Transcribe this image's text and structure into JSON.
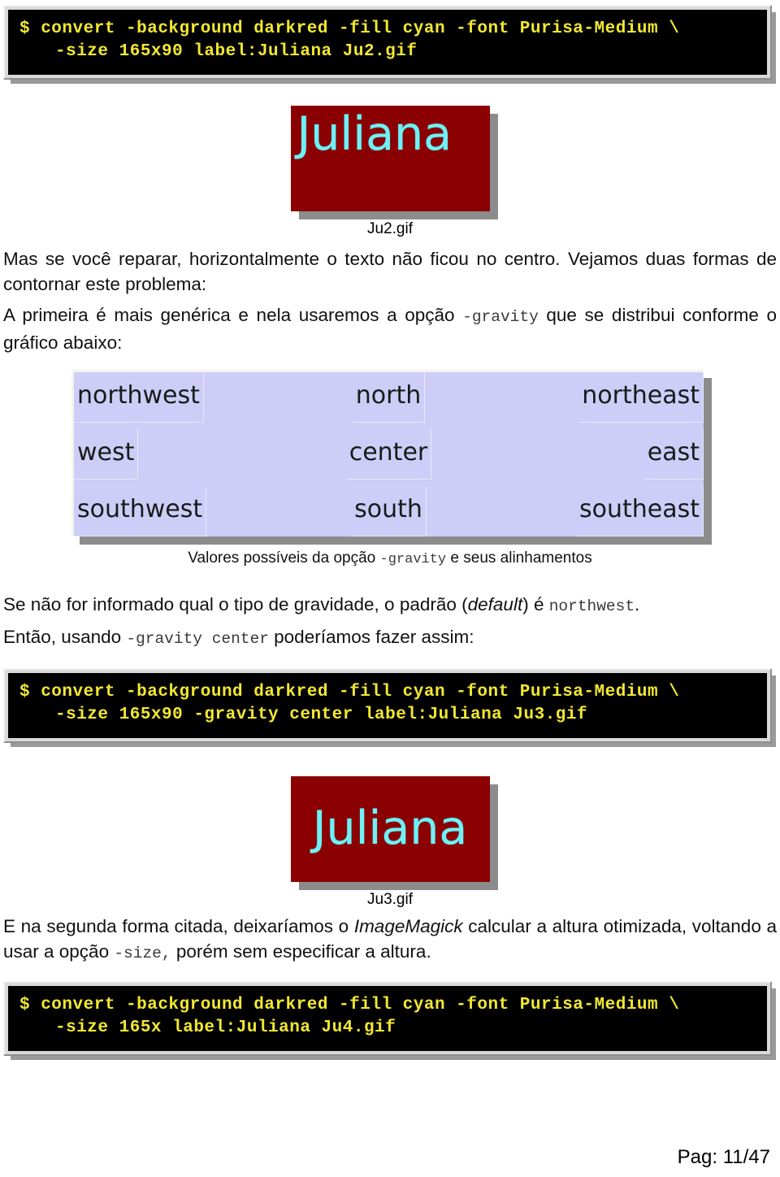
{
  "document": {
    "page_label": "Pag: 11/47"
  },
  "code_blocks": [
    {
      "id": "cmd-ju2",
      "line1": "$ convert -background darkred -fill cyan -font Purisa-Medium \\",
      "line2": "-size 165x90 label:Juliana Ju2.gif"
    },
    {
      "id": "cmd-ju3",
      "line1": "$ convert -background darkred -fill cyan -font Purisa-Medium \\",
      "line2": "-size 165x90 -gravity center label:Juliana Ju3.gif"
    },
    {
      "id": "cmd-ju4",
      "line1": "$ convert -background darkred -fill cyan -font Purisa-Medium \\",
      "line2": "-size 165x label:Juliana Ju4.gif"
    }
  ],
  "figures": [
    {
      "id": "ju2",
      "label": "Juliana",
      "caption": "Ju2.gif",
      "background_color": "#8b0000",
      "text_color": "#6ff0f5",
      "alignment": "northwest"
    },
    {
      "id": "ju3",
      "label": "Juliana",
      "caption": "Ju3.gif",
      "background_color": "#8b0000",
      "text_color": "#6ff0f5",
      "alignment": "center"
    }
  ],
  "paragraphs": {
    "p1_a": "Mas se você reparar, horizontalmente o texto não ficou no centro. Vejamos duas formas de contornar este problema:",
    "p2_a": "A primeira é mais genérica e nela usaremos a opção ",
    "p2_code": "-gravity",
    "p2_b": " que se distribui conforme o gráfico abaixo:",
    "p3_a": "Se não for informado qual o tipo de gravidade, o padrão (",
    "p3_ital": "default",
    "p3_b": ") é ",
    "p3_code": "northwest",
    "p3_c": ".",
    "p4_a": "Então, usando ",
    "p4_code": "-gravity center",
    "p4_b": " poderíamos fazer assim:",
    "p5_a": "E na segunda forma citada, deixaríamos o ",
    "p5_ital": "ImageMagick",
    "p5_b": " calcular a altura otimizada, voltando a usar a opção ",
    "p5_code": "-size,",
    "p5_c": " porém sem especificar a altura."
  },
  "gravity_grid": {
    "caption_a": "Valores possíveis da opção ",
    "caption_code": "-gravity",
    "caption_b": " e seus alinhamentos",
    "background_color": "#cdcdf8",
    "rows": [
      [
        "northwest",
        "north",
        "northeast"
      ],
      [
        "west",
        "center",
        "east"
      ],
      [
        "southwest",
        "south",
        "southeast"
      ]
    ]
  }
}
